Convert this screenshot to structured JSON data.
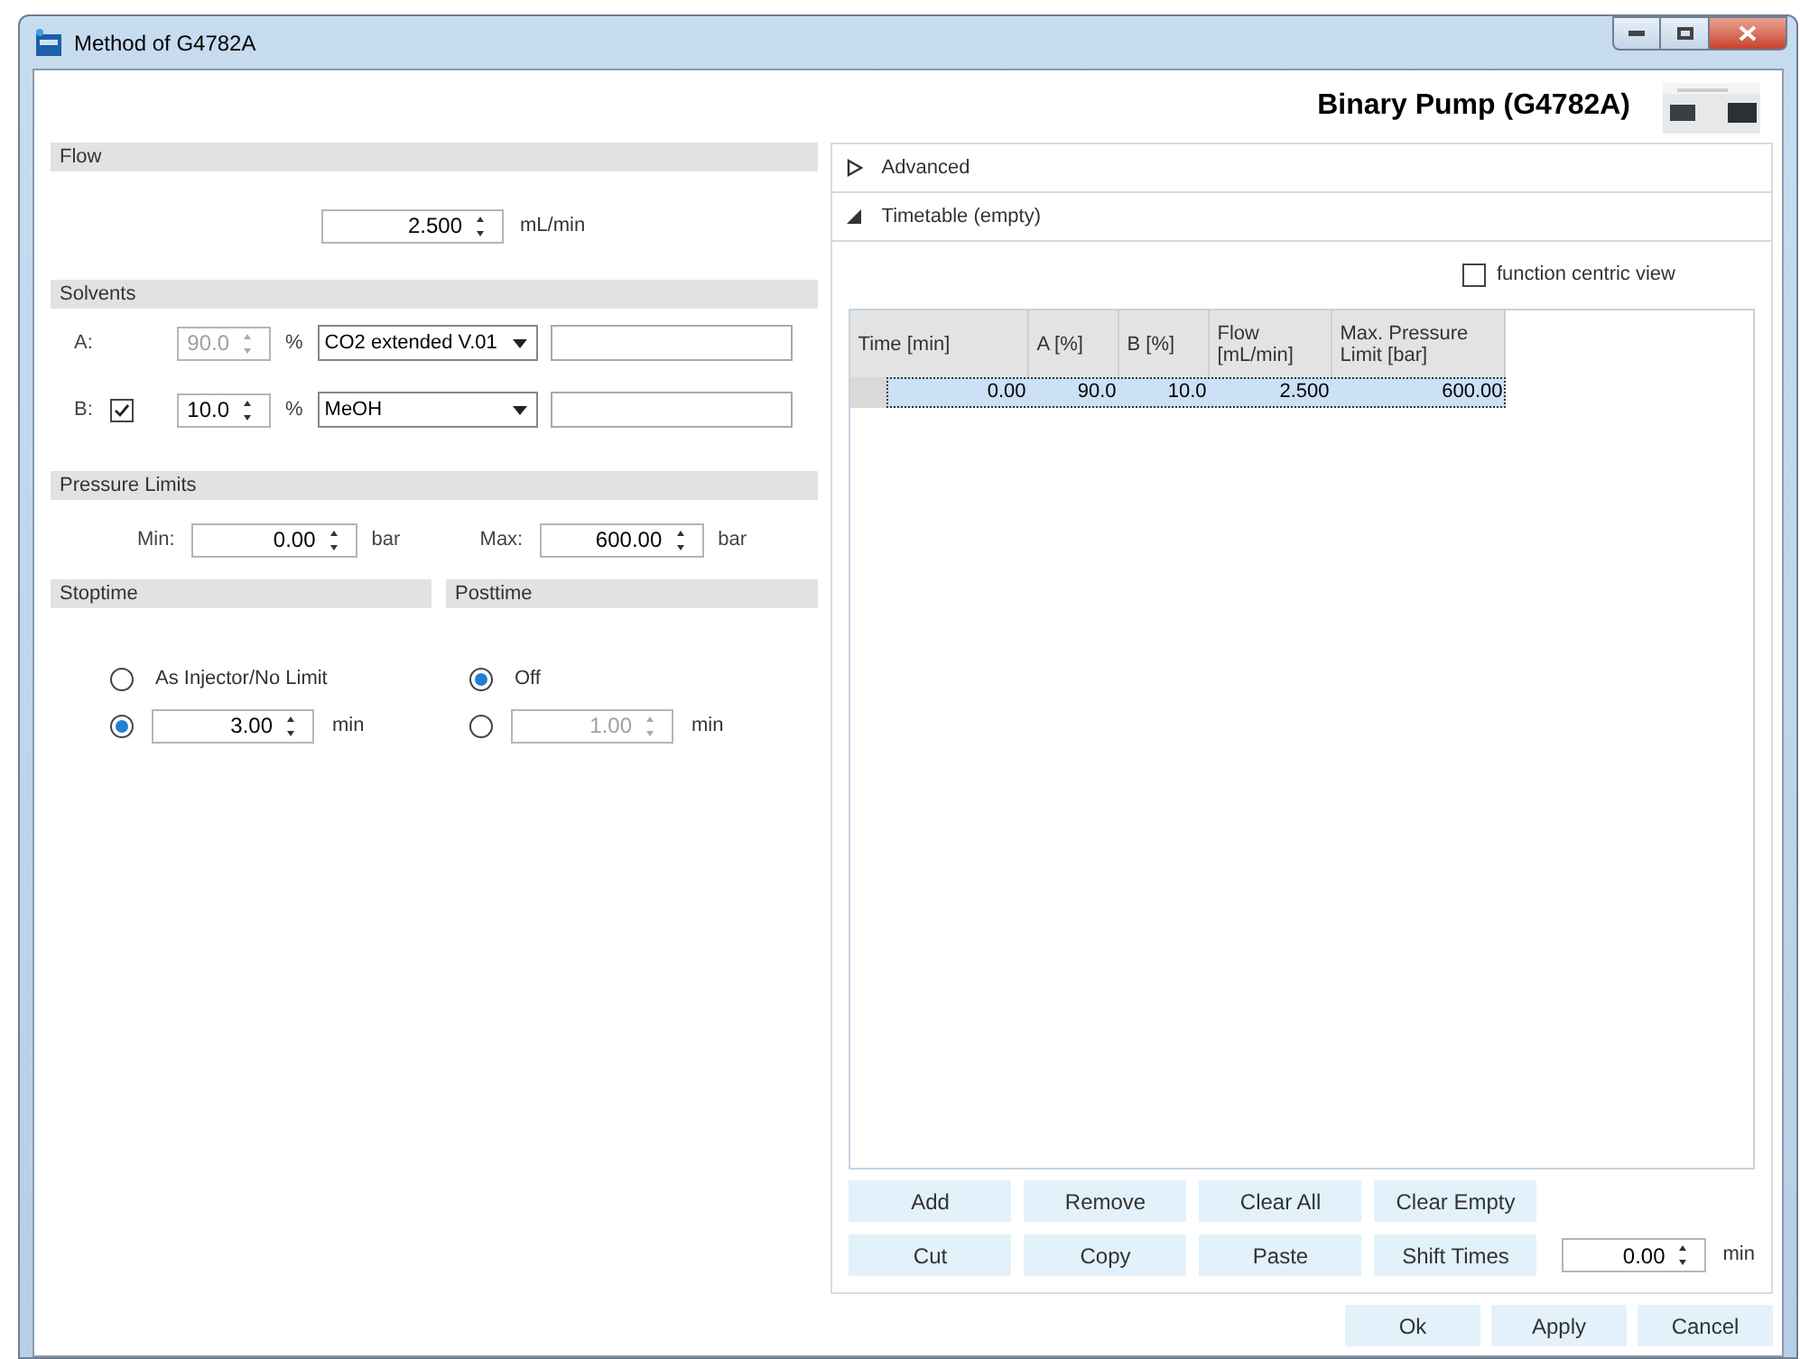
{
  "window": {
    "title": "Method of G4782A"
  },
  "header": {
    "title": "Binary Pump (G4782A)"
  },
  "flow": {
    "title": "Flow",
    "value": "2.500",
    "unit": "mL/min"
  },
  "solvents": {
    "title": "Solvents",
    "channels": [
      {
        "kind": "fixed",
        "label": "A:",
        "percent": "90.0",
        "percent_unit": "%",
        "solvent": "CO2 extended V.01",
        "disabled": true
      },
      {
        "kind": "optional",
        "label": "B:",
        "checked": true,
        "percent": "10.0",
        "percent_unit": "%",
        "solvent": "MeOH",
        "disabled": false
      }
    ]
  },
  "pressure_limits": {
    "title": "Pressure Limits",
    "min_label": "Min:",
    "min_value": "0.00",
    "min_unit": "bar",
    "max_label": "Max:",
    "max_value": "600.00",
    "max_unit": "bar"
  },
  "stoptime": {
    "title": "Stoptime",
    "options": [
      {
        "kind": "label",
        "label": "As Injector/No Limit",
        "selected": false
      },
      {
        "kind": "value",
        "value": "3.00",
        "unit": "min",
        "selected": true,
        "disabled": false
      }
    ]
  },
  "posttime": {
    "title": "Posttime",
    "options": [
      {
        "kind": "label",
        "label": "Off",
        "selected": true
      },
      {
        "kind": "value",
        "value": "1.00",
        "unit": "min",
        "selected": false,
        "disabled": true
      }
    ]
  },
  "sections": [
    {
      "label": "Advanced",
      "expanded": false
    },
    {
      "label": "Timetable (empty)",
      "expanded": true
    }
  ],
  "function_centric_view": {
    "label": "function centric view",
    "checked": false
  },
  "table": {
    "columns": [
      "Time [min]",
      "A [%]",
      "B [%]",
      "Flow [mL/min]",
      "Max. Pressure Limit [bar]"
    ],
    "rows": [
      {
        "cells": [
          "0.00",
          "90.0",
          "10.0",
          "2.500",
          "600.00"
        ],
        "selected": true
      }
    ]
  },
  "table_buttons": [
    [
      "Add",
      "Remove",
      "Clear All",
      "Clear Empty"
    ],
    [
      "Cut",
      "Copy",
      "Paste",
      "Shift Times"
    ]
  ],
  "shift": {
    "value": "0.00",
    "unit": "min"
  },
  "footer_buttons": [
    "Ok",
    "Apply",
    "Cancel"
  ]
}
